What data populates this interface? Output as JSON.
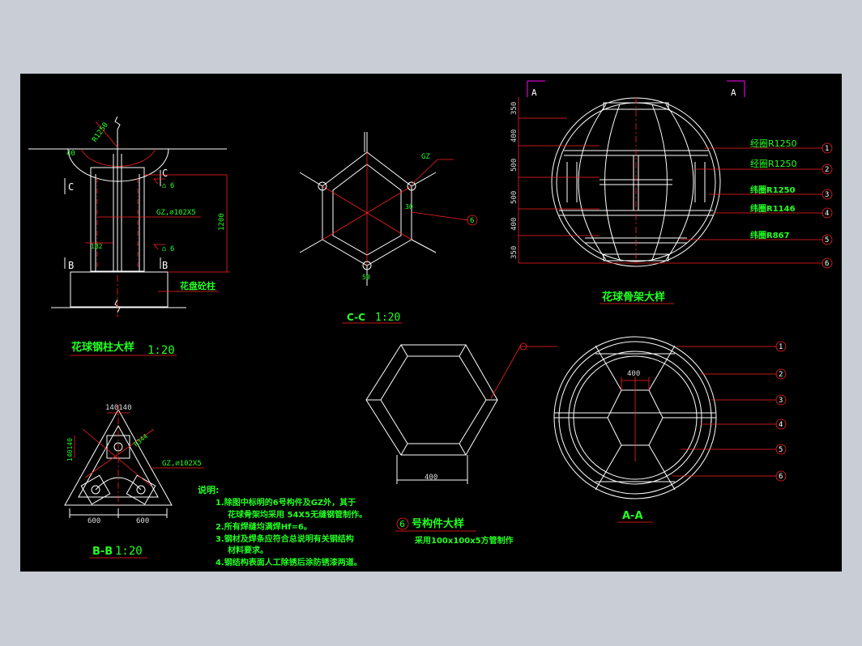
{
  "titles": {
    "column": {
      "name": "花球钢柱大样",
      "scale": "1:20"
    },
    "cc": {
      "name": "C-C",
      "scale": "1:20"
    },
    "skeleton": {
      "name": "花球骨架大样"
    },
    "part6": {
      "num": "6",
      "name": "号构件大样",
      "sub": "采用100x100x5方管制作"
    },
    "aa": {
      "name": "A-A"
    },
    "bb": {
      "name": "B-B",
      "scale": "1:20"
    }
  },
  "column": {
    "radius_label": "R1250",
    "angle_label": "40",
    "section_mark": "C",
    "section_mark_b": "B",
    "weld_1": "6",
    "weld_2": "6",
    "pipe_label": "GZ,⌀102X5",
    "plate_label": "102",
    "height_dim": "1200",
    "base_label": "花盘砼柱"
  },
  "cc": {
    "gz_label": "GZ",
    "dim_30": "30",
    "dim_50": "50",
    "callout": "6"
  },
  "skeleton": {
    "section_mark": "A",
    "dims": [
      "350",
      "400",
      "500",
      "500",
      "400",
      "350"
    ],
    "labels": [
      "经圈R1250",
      "经圈R1250",
      "纬圈R1250",
      "纬圈R1146",
      "纬圈R867"
    ],
    "callouts": [
      "1",
      "2",
      "3",
      "4",
      "5",
      "6"
    ]
  },
  "part6": {
    "width_dim": "400"
  },
  "aa": {
    "top_dim": "400",
    "callouts": [
      "1",
      "2",
      "3",
      "4",
      "5",
      "6"
    ]
  },
  "bb": {
    "dim_top": "140140",
    "dim_left": "140140",
    "radius": "R344",
    "pipe_label": "GZ,⌀102X5",
    "dim_left_bottom": "600",
    "dim_right_bottom": "600"
  },
  "notes": {
    "heading": "说明:",
    "lines": [
      "1.除图中标明的6号构件及GZ外，其于",
      "花球骨架均采用 54X5无缝钢管制作。",
      "2.所有焊缝均满焊Hf=6。",
      "3.钢材及焊条应符合总说明有关钢结构",
      "材料要求。",
      "4.钢结构表面人工除锈后涂防锈漆两道。"
    ]
  },
  "colors": {
    "background": "#000000",
    "frame": "#c9cdd6",
    "line": "#ffffff",
    "dim": "#ff2020",
    "text": "#22ff22",
    "section": "#ff00ff"
  }
}
